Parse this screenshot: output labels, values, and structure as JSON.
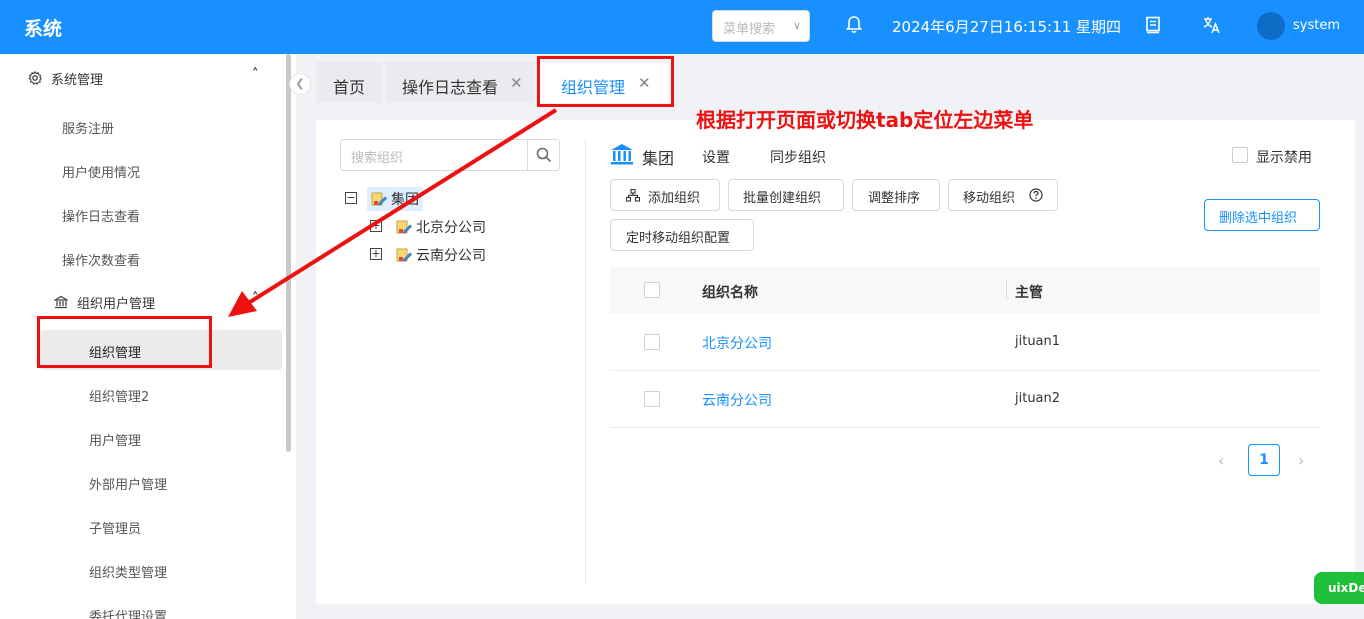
{
  "header": {
    "logo": "系统",
    "menu_search_placeholder": "菜单搜索",
    "datetime": "2024年6月27日16:15:11 星期四",
    "username": "system"
  },
  "sidebar": {
    "group_system": "系统管理",
    "items_top": [
      "服务注册",
      "用户使用情况",
      "操作日志查看",
      "操作次数查看"
    ],
    "group_org": "组织用户管理",
    "items_org": [
      "组织管理",
      "组织管理2",
      "用户管理",
      "外部用户管理",
      "子管理员",
      "组织类型管理",
      "委托代理设置"
    ],
    "active_item": "组织管理"
  },
  "tabs": [
    {
      "label": "首页"
    },
    {
      "label": "操作日志查看"
    },
    {
      "label": "组织管理"
    }
  ],
  "tree": {
    "search_placeholder": "搜索组织",
    "root": "集团",
    "children": [
      "北京分公司",
      "云南分公司"
    ]
  },
  "detail": {
    "title": "集团",
    "links": [
      "设置",
      "同步组织"
    ],
    "show_disabled_label": "显示禁用",
    "buttons": [
      "添加组织",
      "批量创建组织",
      "调整排序",
      "移动组织",
      "定时移动组织配置"
    ],
    "delete_button": "删除选中组织"
  },
  "table": {
    "columns": [
      "组织名称",
      "主管"
    ],
    "rows": [
      {
        "name": "北京分公司",
        "manager": "jituan1"
      },
      {
        "name": "云南分公司",
        "manager": "jituan2"
      }
    ]
  },
  "pagination": {
    "current": "1"
  },
  "annotation": {
    "text": "根据打开页面或切换tab定位左边菜单"
  },
  "badge": "uixDev",
  "colors": {
    "primary": "#1890ff",
    "annotation": "#ee1111",
    "badge": "#1fbf3a"
  }
}
